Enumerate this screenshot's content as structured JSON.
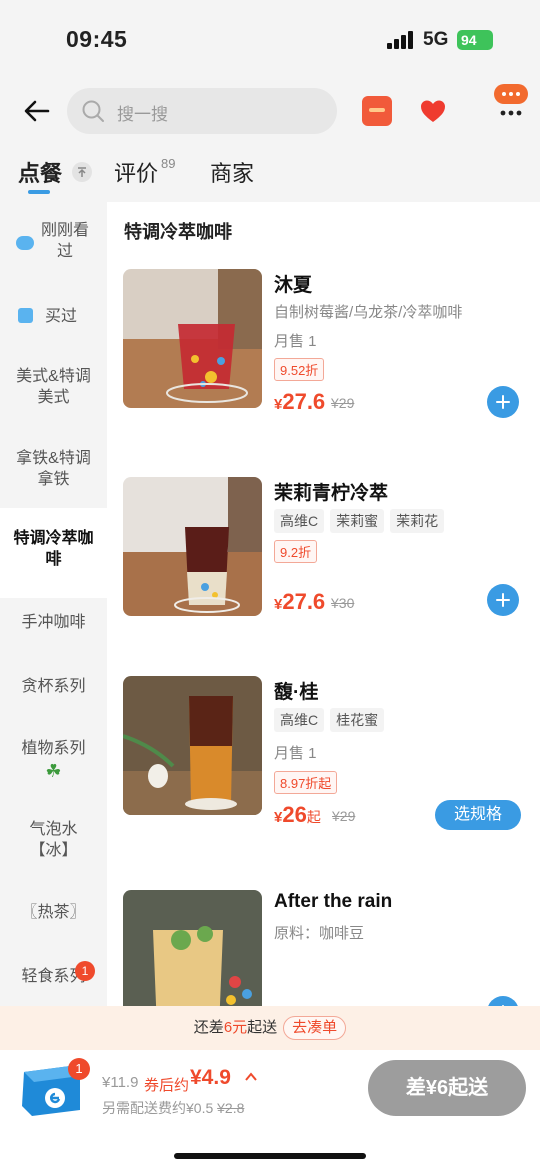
{
  "status_bar": {
    "time": "09:45",
    "network": "5G",
    "battery": "94"
  },
  "header": {
    "search_placeholder": "搜一搜"
  },
  "tabs": [
    {
      "label": "点餐"
    },
    {
      "label": "评价",
      "count": "89"
    },
    {
      "label": "商家"
    }
  ],
  "sidebar": {
    "items": [
      {
        "label": "刚刚看过"
      },
      {
        "label": "买过"
      },
      {
        "label": "美式&特调美式"
      },
      {
        "label": "拿铁&特调拿铁"
      },
      {
        "label": "特调冷萃咖啡",
        "active": true
      },
      {
        "label": "手冲咖啡"
      },
      {
        "label": "贪杯系列"
      },
      {
        "label": "植物系列"
      },
      {
        "label": "气泡水【冰】"
      },
      {
        "label": "〖热茶〗"
      },
      {
        "label": "轻食系列",
        "badge": "1"
      }
    ]
  },
  "section_title": "特调冷萃咖啡",
  "products": [
    {
      "name": "沐夏",
      "desc": "自制树莓酱/乌龙茶/冷萃咖啡",
      "sold": "月售 1",
      "discount": "9.52折",
      "price": "27.6",
      "original": "¥29",
      "action": "add"
    },
    {
      "name": "茉莉青柠冷萃",
      "tags": [
        "高维C",
        "茉莉蜜",
        "茉莉花"
      ],
      "discount": "9.2折",
      "price": "27.6",
      "original": "¥30",
      "action": "add"
    },
    {
      "name": "馥·桂",
      "tags": [
        "高维C",
        "桂花蜜"
      ],
      "sold": "月售 1",
      "discount": "8.97折起",
      "price": "26",
      "price_suffix": "起",
      "original": "¥29",
      "action_label": "选规格"
    },
    {
      "name": "After the rain",
      "desc": "原料：咖啡豆",
      "action": "add"
    }
  ],
  "notice": {
    "prefix": "还差",
    "amount": "6元",
    "suffix": "起送",
    "button": "去凑单"
  },
  "cart": {
    "badge": "1",
    "original_price": "¥11.9",
    "coupon_label": "券后约",
    "final_price": "¥4.9",
    "delivery_prefix": "另需配送费约¥0.5",
    "delivery_old": "¥2.8",
    "checkout_label": "差¥6起送"
  },
  "colors": {
    "accent": "#3a9be3",
    "price": "#ef4a2c"
  }
}
